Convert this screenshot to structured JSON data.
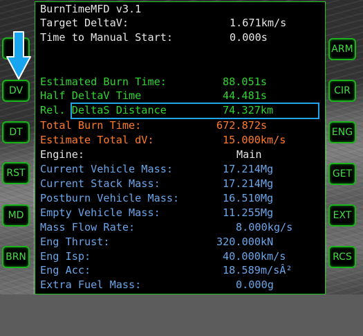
{
  "mfd": {
    "title": "BurnTimeMFD v3.1",
    "target_deltav": {
      "label": "Target DeltaV:",
      "value": "1.671km/s"
    },
    "time_to_manual_start": {
      "label": "Time to Manual Start:",
      "value": "0.000s"
    },
    "estimated_burn_time": {
      "label": "Estimated Burn Time:",
      "value": "88.051s"
    },
    "half_deltav_time": {
      "label": "Half DeltaV Time",
      "value": "44.481s"
    },
    "rel_deltas_distance": {
      "label": "Rel. DeltaS Distance",
      "value": "74.327km"
    },
    "total_burn_time": {
      "label": "Total Burn Time:",
      "value": "672.872s"
    },
    "estimate_total_dv": {
      "label": "Estimate Total dV:",
      "value": "15.000km/s"
    },
    "engine": {
      "label": "Engine:",
      "value": "Main"
    },
    "current_vehicle_mass": {
      "label": "Current Vehicle Mass:",
      "value": "17.214Mg"
    },
    "current_stack_mass": {
      "label": "Current Stack Mass:",
      "value": "17.214Mg"
    },
    "postburn_vehicle_mass": {
      "label": "Postburn Vehicle Mass:",
      "value": "16.510Mg"
    },
    "empty_vehicle_mass": {
      "label": "Empty Vehicle Mass:",
      "value": "11.255Mg"
    },
    "mass_flow_rate": {
      "label": "Mass Flow Rate:",
      "value": "8.000kg/s"
    },
    "eng_thrust": {
      "label": "Eng Thrust:",
      "value": "320.000kN"
    },
    "eng_isp": {
      "label": "Eng Isp:",
      "value": "40.000km/s"
    },
    "eng_acc": {
      "label": "Eng Acc:",
      "value": "18.589m/sÂ²"
    },
    "extra_fuel_mass": {
      "label": "Extra Fuel Mass:",
      "value": "0.000g"
    }
  },
  "left_buttons": [
    "DV",
    "DT",
    "RST",
    "MD",
    "BRN"
  ],
  "right_buttons": [
    "ARM",
    "CIR",
    "ENG",
    "GET",
    "EXT",
    "RCS"
  ],
  "colors": {
    "frame_green": "#23c523",
    "white_text": "#e6e6e6",
    "green_text": "#31d431",
    "orange_text": "#ff7a28",
    "blue_text": "#6aa6ea",
    "highlight_cyan": "#1ea6e8",
    "arrow_blue": "#19a4f0"
  },
  "icons": {
    "pointer": "down-arrow-icon"
  }
}
